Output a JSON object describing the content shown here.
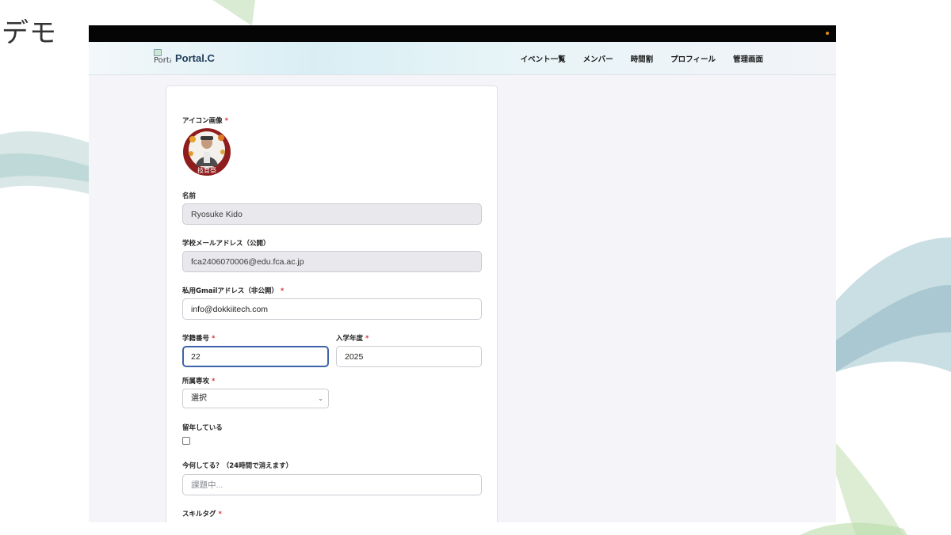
{
  "slide": {
    "title": "デモ"
  },
  "app": {
    "brand_logo_alt": "Portal",
    "brand_name": "Portal.C",
    "nav": [
      "イベント一覧",
      "メンバー",
      "時間割",
      "プロフィール",
      "管理画面"
    ]
  },
  "form": {
    "icon_label": "アイコン画像",
    "avatar_caption": "技育祭",
    "name_label": "名前",
    "name_value": "Ryosuke Kido",
    "school_email_label": "学校メールアドレス（公開）",
    "school_email_value": "fca2406070006@edu.fca.ac.jp",
    "private_email_label": "私用Gmailアドレス（非公開）",
    "private_email_value": "info@dokkiitech.com",
    "student_number_label": "学籍番号",
    "student_number_value": "22",
    "entry_year_label": "入学年度",
    "entry_year_value": "2025",
    "major_label": "所属専攻",
    "major_selected": "選択",
    "repeat_label": "留年している",
    "status_label": "今何してる？（24時間で消えます）",
    "status_placeholder": "課題中...",
    "skill_tag_label": "スキルタグ",
    "required_mark": "*"
  },
  "colors": {
    "focus_border": "#3e63a8",
    "required": "#d9343c",
    "brand_text": "#1f3c58"
  }
}
